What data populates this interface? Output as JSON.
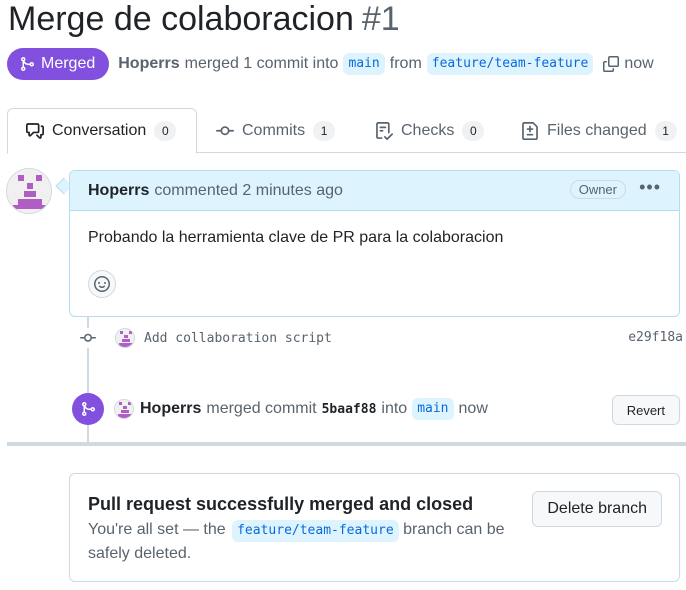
{
  "pr": {
    "title": "Merge de colaboracion",
    "number": "#1",
    "state": "Merged",
    "author": "Hoperrs",
    "merged_text": "merged 1 commit into",
    "base_branch": "main",
    "from_text": "from",
    "head_branch": "feature/team-feature",
    "time": "now"
  },
  "tabs": [
    {
      "label": "Conversation",
      "count": "0",
      "icon": "comment-discussion-icon"
    },
    {
      "label": "Commits",
      "count": "1",
      "icon": "commit-icon"
    },
    {
      "label": "Checks",
      "count": "0",
      "icon": "checklist-icon"
    },
    {
      "label": "Files changed",
      "count": "1",
      "icon": "file-diff-icon"
    }
  ],
  "comment": {
    "author": "Hoperrs",
    "meta": "commented 2 minutes ago",
    "role": "Owner",
    "body": "Probando la herramienta clave de PR para la colaboracion"
  },
  "commit": {
    "message": "Add collaboration script",
    "sha": "e29f18a"
  },
  "merge_event": {
    "author": "Hoperrs",
    "text1": "merged commit",
    "sha": "5baaf88",
    "text2": "into",
    "branch": "main",
    "time": "now",
    "revert_label": "Revert"
  },
  "merge_box": {
    "title": "Pull request successfully merged and closed",
    "text_before": "You're all set — the",
    "branch": "feature/team-feature",
    "text_after": "branch can be safely deleted.",
    "delete_label": "Delete branch"
  },
  "colors": {
    "merged_purple": "#8250df",
    "link_blue": "#0969da",
    "branch_bg": "#ddf4ff",
    "avatar_purple": "#b05ec4"
  }
}
